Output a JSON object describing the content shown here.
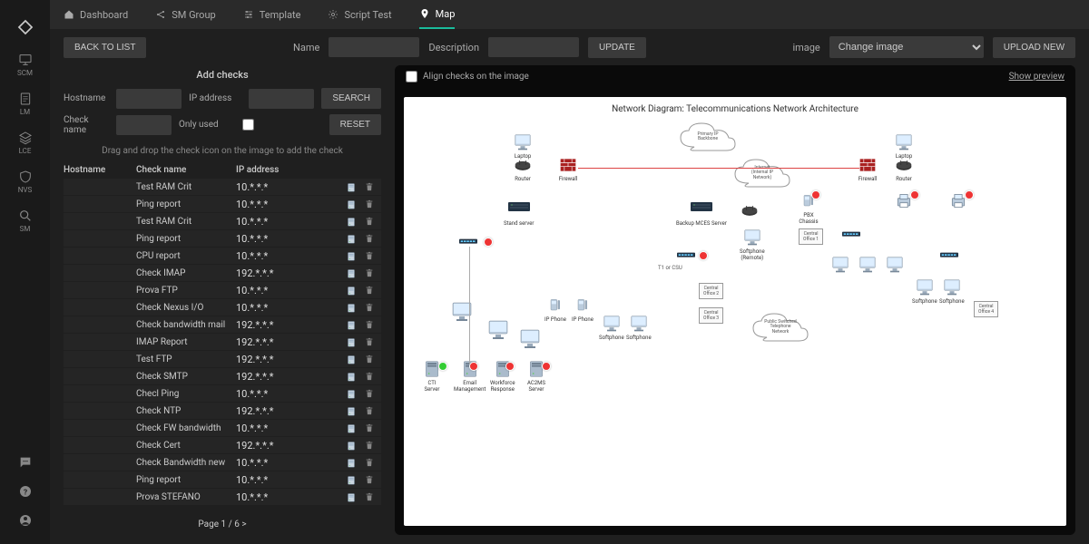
{
  "sidebar": {
    "items": [
      {
        "id": "scm",
        "label": "SCM"
      },
      {
        "id": "lm",
        "label": "LM"
      },
      {
        "id": "lce",
        "label": "LCE"
      },
      {
        "id": "nvs",
        "label": "NVS"
      },
      {
        "id": "sm",
        "label": "SM"
      }
    ]
  },
  "topbar": {
    "items": [
      {
        "id": "dashboard",
        "label": "Dashboard"
      },
      {
        "id": "smgroup",
        "label": "SM Group"
      },
      {
        "id": "template",
        "label": "Template"
      },
      {
        "id": "scripttest",
        "label": "Script Test"
      },
      {
        "id": "map",
        "label": "Map",
        "active": true
      }
    ]
  },
  "toolbar": {
    "back": "BACK TO LIST",
    "name_label": "Name",
    "name_value": "",
    "desc_label": "Description",
    "desc_value": "",
    "update": "UPDATE",
    "image_label": "image",
    "image_select": "Change image",
    "upload": "UPLOAD NEW"
  },
  "addchecks": {
    "title": "Add checks",
    "hostname_label": "Hostname",
    "ip_label": "IP address",
    "search": "SEARCH",
    "checkname_label": "Check name",
    "onlyused_label": "Only used",
    "reset": "RESET",
    "hint": "Drag and drop the check icon on the image to add the check",
    "headers": {
      "hostname": "Hostname",
      "checkname": "Check name",
      "ip": "IP address"
    },
    "rows": [
      {
        "check": "Test RAM Crit",
        "ip": "10.*.*.*"
      },
      {
        "check": "Ping report",
        "ip": "10.*.*.*"
      },
      {
        "check": "Test RAM Crit",
        "ip": "10.*.*.*"
      },
      {
        "check": "Ping report",
        "ip": "10.*.*.*"
      },
      {
        "check": "CPU report",
        "ip": "10.*.*.*"
      },
      {
        "check": "Check IMAP",
        "ip": "192.*.*.*"
      },
      {
        "check": "Prova FTP",
        "ip": "10.*.*.*"
      },
      {
        "check": "Check Nexus I/O",
        "ip": "10.*.*.*"
      },
      {
        "check": "Check bandwidth mail",
        "ip": "192.*.*.*"
      },
      {
        "check": "IMAP Report",
        "ip": "192.*.*.*"
      },
      {
        "check": "Test FTP",
        "ip": "192.*.*.*"
      },
      {
        "check": "Check SMTP",
        "ip": "192.*.*.*"
      },
      {
        "check": "Checl Ping",
        "ip": "10.*.*.*"
      },
      {
        "check": "Check NTP",
        "ip": "192.*.*.*"
      },
      {
        "check": "Check FW bandwidth",
        "ip": "10.*.*.*"
      },
      {
        "check": "Check Cert",
        "ip": "192.*.*.*"
      },
      {
        "check": "Check Bandwidth new",
        "ip": "10.*.*.*"
      },
      {
        "check": "Ping report",
        "ip": "10.*.*.*"
      },
      {
        "check": "Prova STEFANO",
        "ip": "10.*.*.*"
      }
    ],
    "pagination": "Page 1 / 6 >"
  },
  "map": {
    "align_label": "Align checks on the image",
    "preview": "Show preview",
    "title": "Network Diagram: Telecommunications Network Architecture"
  }
}
